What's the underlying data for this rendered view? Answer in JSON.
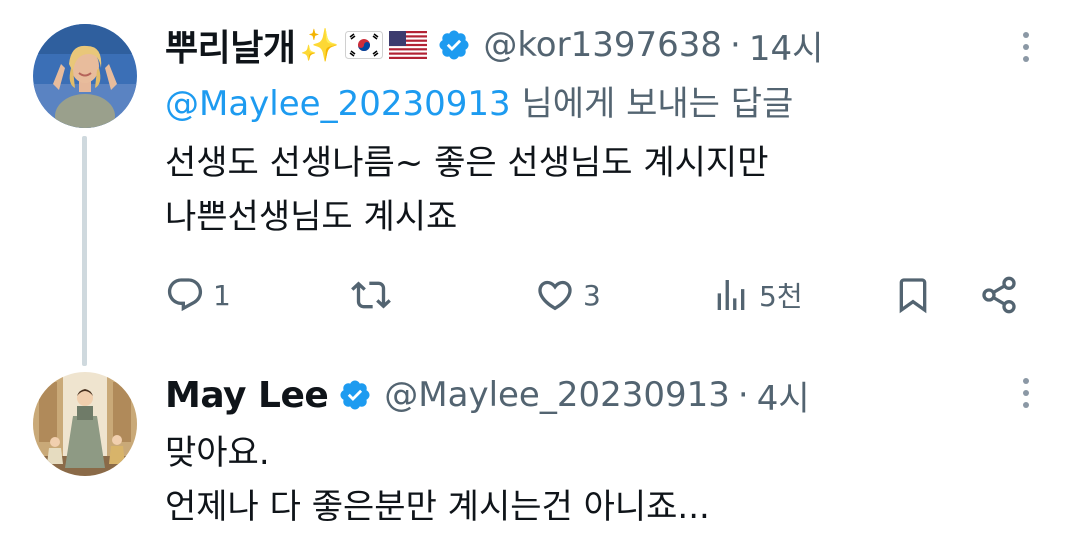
{
  "tweets": [
    {
      "display_name": "뿌리날개",
      "name_emojis": [
        "sparkles",
        "flag-kr",
        "flag-us"
      ],
      "sparkles": "✨",
      "verified": true,
      "handle": "@kor1397638",
      "separator": "·",
      "time": "14시",
      "reply_to": {
        "mention": "@Maylee_20230913",
        "suffix": " 님에게 보내는 답글"
      },
      "text_lines": [
        "선생도 선생나름~ 좋은 선생님도 계시지만",
        "나쁜선생님도 계시죠"
      ],
      "actions": {
        "reply_count": "1",
        "repost_count": "",
        "like_count": "3",
        "views_count": "5천"
      },
      "avatar_icon": "user-avatar-woman-blonde"
    },
    {
      "display_name": "May Lee",
      "verified": true,
      "handle": "@Maylee_20230913",
      "separator": "·",
      "time": "4시",
      "text_lines": [
        "맞아요.",
        "언제나 다 좋은분만 계시는건 아니죠..."
      ],
      "avatar_icon": "user-avatar-illustration"
    }
  ],
  "colors": {
    "text_primary": "#0f1419",
    "text_secondary": "#536471",
    "link": "#1d9bf0",
    "verified": "#1d9bf0",
    "thread_line": "#cfd9de"
  }
}
